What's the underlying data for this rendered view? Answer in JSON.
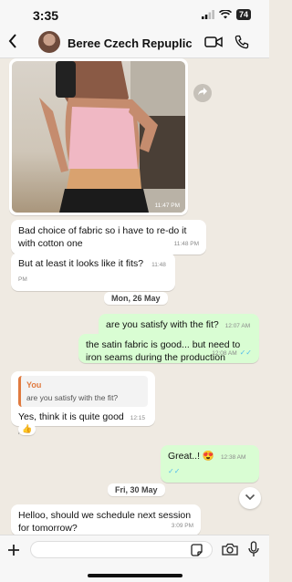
{
  "status_bar": {
    "time": "3:35",
    "battery": "74"
  },
  "header": {
    "contact_name": "Beree Czech Repuplic"
  },
  "photo_message": {
    "time": "11:47 PM"
  },
  "messages": [
    {
      "text": "Bad choice of fabric so i have to re-do it with cotton one",
      "time": "11:48 PM"
    },
    {
      "text": "But at least it looks like it fits?",
      "time": "11:48 PM"
    },
    {
      "text": "are you satisfy with the fit?",
      "time": "12:07 AM"
    },
    {
      "text": "the satin fabric is good... but need to iron seams during the production",
      "time": "12:08 AM"
    },
    {
      "quote_name": "You",
      "quote_text": "are you satisfy with the fit?",
      "text": "Yes, think it is quite good",
      "time": "12:15 AM",
      "reaction": "👍"
    },
    {
      "text": "Great..! 😍",
      "time": "12:38 AM"
    },
    {
      "text": "Helloo, should we schedule next session for tomorrow?",
      "time": "3:09 PM"
    }
  ],
  "dates": {
    "first": "Mon, 26 May",
    "second": "Fri, 30 May"
  },
  "icons": {
    "back": "chevron-left-icon",
    "video": "video-camera-icon",
    "call": "phone-icon",
    "forward": "forward-icon",
    "scroll": "chevron-down-icon",
    "plus": "plus-icon",
    "sticker": "sticker-icon",
    "camera": "camera-icon",
    "mic": "microphone-icon"
  },
  "colors": {
    "chat_bg": "#efeae2",
    "outgoing": "#d9fdd3",
    "incoming": "#ffffff",
    "read_ticks": "#53bdeb",
    "quote_accent": "#e07a3f"
  }
}
